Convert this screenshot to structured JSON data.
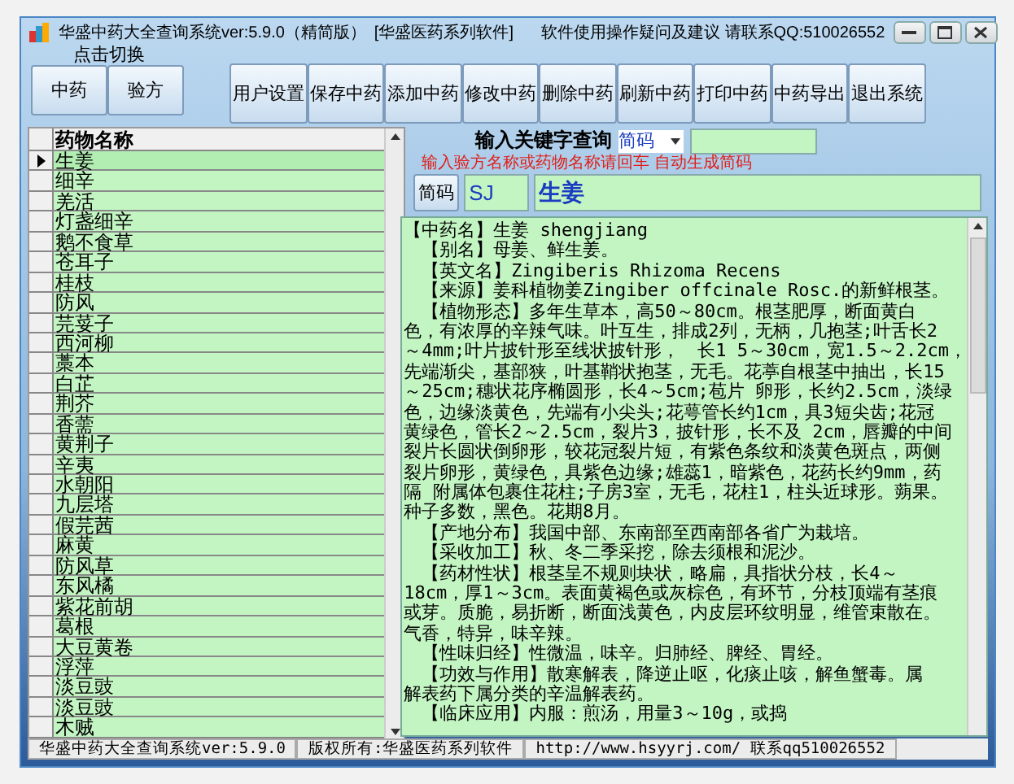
{
  "window": {
    "title": "华盛中药大全查询系统ver:5.9.0（精简版）",
    "subtitle": "[华盛医药系列软件]",
    "notice": "软件使用操作疑问及建议 请联系QQ:510026552"
  },
  "switch": {
    "label": "点击切换",
    "buttons": [
      "中药",
      "验方"
    ]
  },
  "toolbar": [
    "用户设置",
    "保存中药",
    "添加中药",
    "修改中药",
    "删除中药",
    "刷新中药",
    "打印中药",
    "中药导出",
    "退出系统"
  ],
  "grid": {
    "columns": [
      "药物名称"
    ],
    "rows": [
      {
        "name": "生姜",
        "selected": true
      },
      {
        "name": "细辛",
        "selected": false
      },
      {
        "name": "羌活",
        "selected": false
      },
      {
        "name": "灯盏细辛",
        "selected": false
      },
      {
        "name": "鹅不食草",
        "selected": false
      },
      {
        "name": "苍耳子",
        "selected": false
      },
      {
        "name": "桂枝",
        "selected": false
      },
      {
        "name": "防风",
        "selected": false
      },
      {
        "name": "芫荽子",
        "selected": false
      },
      {
        "name": "西河柳",
        "selected": false
      },
      {
        "name": "藁本",
        "selected": false
      },
      {
        "name": "白芷",
        "selected": false
      },
      {
        "name": "荆芥",
        "selected": false
      },
      {
        "name": "香薷",
        "selected": false
      },
      {
        "name": "黄荆子",
        "selected": false
      },
      {
        "name": "辛夷",
        "selected": false
      },
      {
        "name": "水朝阳",
        "selected": false
      },
      {
        "name": "九层塔",
        "selected": false
      },
      {
        "name": "假芫茜",
        "selected": false
      },
      {
        "name": "麻黄",
        "selected": false
      },
      {
        "name": "防风草",
        "selected": false
      },
      {
        "name": "东风橘",
        "selected": false
      },
      {
        "name": "紫花前胡",
        "selected": false
      },
      {
        "name": "葛根",
        "selected": false
      },
      {
        "name": "大豆黄卷",
        "selected": false
      },
      {
        "name": "浮萍",
        "selected": false
      },
      {
        "name": "淡豆豉",
        "selected": false
      },
      {
        "name": "淡豆豉",
        "selected": false
      },
      {
        "name": "木贼",
        "selected": false
      }
    ]
  },
  "search": {
    "label": "输入关键字查询",
    "mode": "简码",
    "hint": "输入验方名称或药物名称请回车 自动生成简码",
    "code_button": "简码",
    "code": "SJ",
    "name": "生姜"
  },
  "detail": {
    "lines": [
      "【中药名】生姜 shengjiang",
      "　【别名】母姜、鲜生姜。",
      "　【英文名】Zingiberis Rhizoma Recens",
      "　【来源】姜科植物姜Zingiber offcinale Rosc.的新鲜根茎。",
      "　【植物形态】多年生草本，高50～80cm。根茎肥厚，断面黄白",
      "色，有浓厚的辛辣气味。叶互生，排成2列，无柄，几抱茎;叶舌长2",
      "～4mm;叶片披针形至线状披针形，　长1 5～30cm，宽1.5～2.2cm，",
      "先端渐尖，基部狭，叶基鞘状抱茎，无毛。花葶自根茎中抽出，长15",
      "～25cm;穗状花序椭圆形，长4～5cm;苞片 卵形，长约2.5cm，淡绿",
      "色，边缘淡黄色，先端有小尖头;花萼管长约1cm，具3短尖齿;花冠",
      "黄绿色，管长2～2.5cm，裂片3，披针形，长不及 2cm，唇瓣的中间",
      "裂片长圆状倒卵形，较花冠裂片短，有紫色条纹和淡黄色斑点，两侧",
      "裂片卵形，黄绿色，具紫色边缘;雄蕊1，暗紫色，花药长约9mm，药",
      "隔 附属体包裹住花柱;子房3室，无毛，花柱1，柱头近球形。蒴果。",
      "种子多数，黑色。花期8月。",
      "　【产地分布】我国中部、东南部至西南部各省广为栽培。",
      "　【采收加工】秋、冬二季采挖，除去须根和泥沙。",
      "　【药材性状】根茎呈不规则块状，略扁，具指状分枝，长4～",
      "18cm，厚1～3cm。表面黄褐色或灰棕色，有环节，分枝顶端有茎痕",
      "或芽。质脆，易折断，断面浅黄色，内皮层环纹明显，维管束散在。",
      "气香，特异，味辛辣。",
      "　【性味归经】性微温，味辛。归肺经、脾经、胃经。",
      "　【功效与作用】散寒解表，降逆止呕，化痰止咳，解鱼蟹毒。属",
      "解表药下属分类的辛温解表药。",
      "　【临床应用】内服：煎汤，用量3～10g，或捣"
    ]
  },
  "status_bar": [
    "华盛中药大全查询系统ver:5.9.0",
    "版权所有:华盛医药系列软件",
    "http://www.hsyyrj.com/  联系qq510026552"
  ]
}
